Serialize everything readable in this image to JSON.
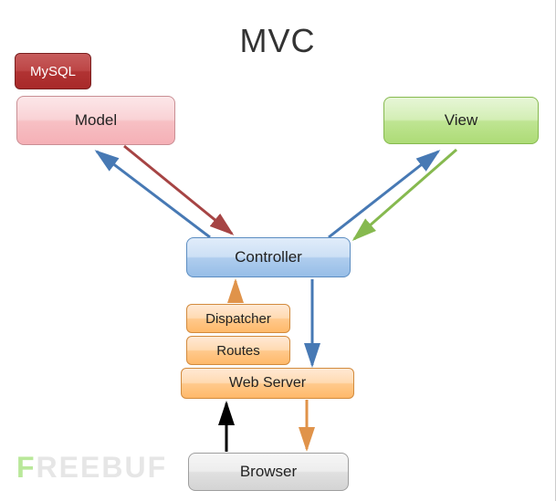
{
  "title": "MVC",
  "nodes": {
    "mysql": "MySQL",
    "model": "Model",
    "view": "View",
    "controller": "Controller",
    "dispatcher": "Dispatcher",
    "routes": "Routes",
    "webserver": "Web Server",
    "browser": "Browser"
  },
  "watermark": "FREEBUF",
  "chart_data": {
    "type": "diagram",
    "title": "MVC",
    "nodes": [
      {
        "id": "mysql",
        "label": "MySQL",
        "color": "#b13333"
      },
      {
        "id": "model",
        "label": "Model",
        "color": "#f7c0c4"
      },
      {
        "id": "view",
        "label": "View",
        "color": "#bfe593"
      },
      {
        "id": "controller",
        "label": "Controller",
        "color": "#afcdee"
      },
      {
        "id": "dispatcher",
        "label": "Dispatcher",
        "color": "#ffc98c"
      },
      {
        "id": "routes",
        "label": "Routes",
        "color": "#ffc98c"
      },
      {
        "id": "webserver",
        "label": "Web Server",
        "color": "#ffc98c"
      },
      {
        "id": "browser",
        "label": "Browser",
        "color": "#e0e0e0"
      }
    ],
    "edges": [
      {
        "from": "controller",
        "to": "model",
        "color": "blue"
      },
      {
        "from": "model",
        "to": "controller",
        "color": "red"
      },
      {
        "from": "controller",
        "to": "view",
        "color": "blue"
      },
      {
        "from": "view",
        "to": "controller",
        "color": "green"
      },
      {
        "from": "dispatcher",
        "to": "controller",
        "color": "orange"
      },
      {
        "from": "controller",
        "to": "webserver",
        "color": "blue",
        "via": "right"
      },
      {
        "from": "browser",
        "to": "webserver",
        "color": "black"
      },
      {
        "from": "webserver",
        "to": "browser",
        "color": "orange"
      }
    ],
    "relation": "mysql attached to model"
  }
}
